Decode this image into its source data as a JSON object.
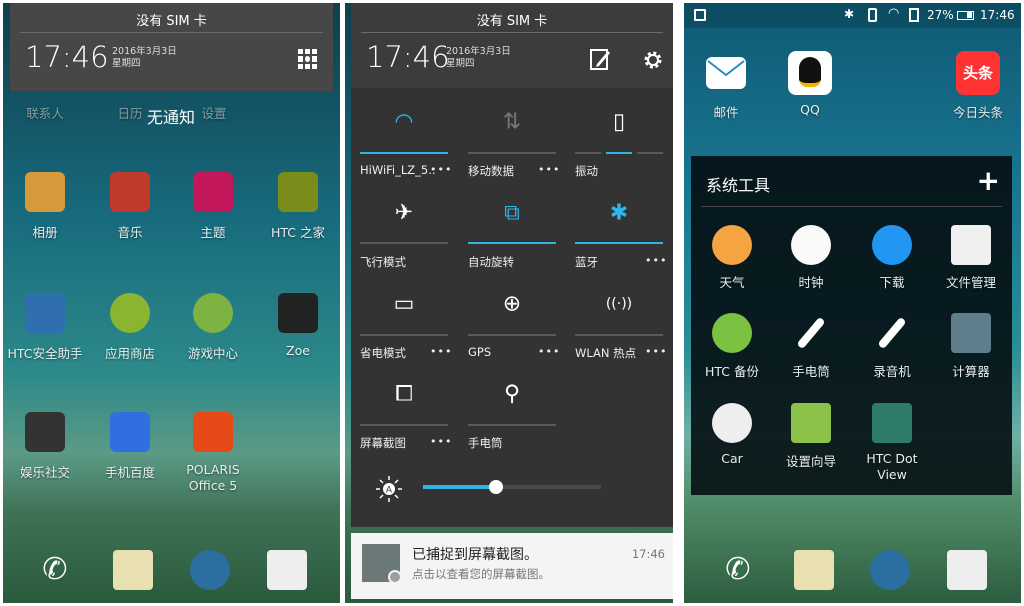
{
  "panel1": {
    "shade": {
      "sim_status": "没有 SIM 卡",
      "time": "17:46",
      "date": "2016年3月3日",
      "weekday": "星期四",
      "toggle_icon": "quick-settings-grid-icon"
    },
    "empty_notice": "无通知",
    "partial_labels": [
      "联系人",
      "日历",
      "设置"
    ],
    "apps": [
      {
        "label": "相册",
        "icon": "gallery-icon",
        "color": "#d79a3a"
      },
      {
        "label": "音乐",
        "icon": "headphones-icon",
        "color": "#c0392b"
      },
      {
        "label": "主题",
        "icon": "themes-icon",
        "color": "#c2185b"
      },
      {
        "label": "HTC 之家",
        "icon": "htc-shield-icon",
        "color": "#7a8c1a"
      },
      {
        "label": "HTC安全助手",
        "icon": "security-shield-icon",
        "color": "#2f6fb0"
      },
      {
        "label": "应用商店",
        "icon": "app-store-icon",
        "color": "#8bb530"
      },
      {
        "label": "游戏中心",
        "icon": "game-center-icon",
        "color": "#7cb342"
      },
      {
        "label": "Zoe",
        "icon": "zoe-icon",
        "color": "#222"
      },
      {
        "label": "娱乐社交",
        "icon": "folder-icon",
        "color": "#333"
      },
      {
        "label": "手机百度",
        "icon": "baidu-icon",
        "color": "#2f6fe0"
      },
      {
        "label": "POLARIS",
        "label2": "Office 5",
        "icon": "polaris-office-icon",
        "color": "#e64a19"
      }
    ],
    "dock": [
      "phone-icon",
      "messages-icon",
      "browser-globe-icon",
      "camera-icon"
    ]
  },
  "panel2": {
    "header": {
      "sim_status": "没有 SIM 卡",
      "time": "17:46",
      "date": "2016年3月3日",
      "weekday": "星期四",
      "edit_icon": "edit-icon",
      "settings_icon": "gear-icon"
    },
    "tiles": [
      {
        "label": "HiWiFi_LZ_5..",
        "icon": "wifi-icon",
        "on": true,
        "more": true
      },
      {
        "label": "移动数据",
        "icon": "mobile-data-icon",
        "on": false,
        "more": true
      },
      {
        "label": "振动",
        "icon": "vibrate-icon",
        "on": "partial",
        "more": false
      },
      {
        "label": "飞行模式",
        "icon": "airplane-icon",
        "on": false,
        "more": false
      },
      {
        "label": "自动旋转",
        "icon": "auto-rotate-icon",
        "on": true,
        "more": false
      },
      {
        "label": "蓝牙",
        "icon": "bluetooth-icon",
        "on": true,
        "more": true
      },
      {
        "label": "省电模式",
        "icon": "power-saver-icon",
        "on": false,
        "more": true
      },
      {
        "label": "GPS",
        "icon": "gps-icon",
        "on": false,
        "more": true
      },
      {
        "label": "WLAN 热点",
        "icon": "hotspot-icon",
        "on": false,
        "more": true
      },
      {
        "label": "屏幕截图",
        "icon": "screenshot-icon",
        "on": false,
        "more": true
      },
      {
        "label": "手电筒",
        "icon": "flashlight-icon",
        "on": false,
        "more": false
      }
    ],
    "more_glyph": "•••",
    "brightness": {
      "icon": "auto-brightness-icon",
      "level_percent": 41
    },
    "notification": {
      "title": "已捕捉到屏幕截图。",
      "text": "点击以查看您的屏幕截图。",
      "time": "17:46"
    },
    "accent": "#2fb5e6"
  },
  "panel3": {
    "status": {
      "battery": "27%",
      "time": "17:46"
    },
    "apps": [
      {
        "label": "邮件",
        "icon": "mail-icon"
      },
      {
        "label": "QQ",
        "icon": "qq-penguin-icon"
      },
      {
        "label": "今日头条",
        "icon": "toutiao-icon",
        "text": "头条"
      }
    ],
    "folder": {
      "title": "系统工具",
      "add_icon": "plus-icon",
      "apps": [
        {
          "label": "天气",
          "icon": "weather-icon",
          "color": "#f5a442"
        },
        {
          "label": "时钟",
          "icon": "clock-icon",
          "color": "#fafafa"
        },
        {
          "label": "下载",
          "icon": "download-icon",
          "color": "#2196f3"
        },
        {
          "label": "文件管理",
          "icon": "file-manager-icon",
          "color": "#f0f0f0"
        },
        {
          "label": "HTC 备份",
          "icon": "htc-backup-icon",
          "color": "#7cc242"
        },
        {
          "label": "手电筒",
          "icon": "flashlight-icon",
          "color": "#ffffff"
        },
        {
          "label": "录音机",
          "icon": "voice-recorder-icon",
          "color": "#ffffff"
        },
        {
          "label": "计算器",
          "icon": "calculator-icon",
          "color": "#607d8b"
        },
        {
          "label": "Car",
          "icon": "car-steering-icon",
          "color": "#eeeeee"
        },
        {
          "label": "设置向导",
          "icon": "setup-wizard-icon",
          "color": "#8bc34a"
        },
        {
          "label": "HTC Dot",
          "label2": "View",
          "icon": "dot-view-icon",
          "color": "#2e7d6b"
        }
      ]
    },
    "dock": [
      "phone-icon",
      "messages-icon",
      "browser-globe-icon",
      "camera-icon"
    ]
  }
}
